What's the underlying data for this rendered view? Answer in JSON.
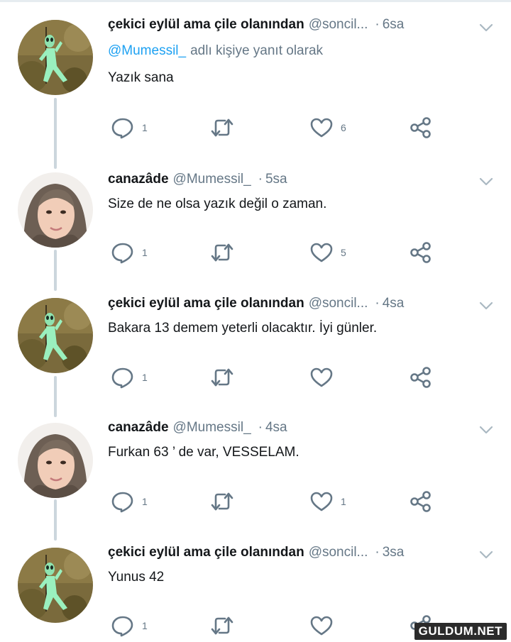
{
  "tweets": [
    {
      "author": "çekici eylül ama çile olanından",
      "handle": "@soncil...",
      "time": "6sa",
      "reply_to_handle": "@Mumessil_",
      "reply_to_suffix": "adlı kişiye yanıt olarak",
      "text": "Yazık sana",
      "replies": "1",
      "likes": "6",
      "avatar": "alien"
    },
    {
      "author": "canazâde",
      "handle": "@Mumessil_",
      "time": "5sa",
      "text": "Size de ne olsa yazık değil o zaman.",
      "replies": "1",
      "likes": "5",
      "avatar": "woman"
    },
    {
      "author": "çekici eylül ama çile olanından",
      "handle": "@soncil...",
      "time": "4sa",
      "text": "Bakara 13 demem yeterli olacaktır. İyi günler.",
      "replies": "1",
      "likes": "",
      "avatar": "alien"
    },
    {
      "author": "canazâde",
      "handle": "@Mumessil_",
      "time": "4sa",
      "text": "Furkan 63 ’ de var, VESSELAM.",
      "replies": "1",
      "likes": "1",
      "avatar": "woman"
    },
    {
      "author": "çekici eylül ama çile olanından",
      "handle": "@soncil...",
      "time": "3sa",
      "text": "Yunus 42",
      "replies": "1",
      "likes": "",
      "avatar": "alien"
    }
  ],
  "separator": "·",
  "icons": {
    "reply": "reply-icon",
    "retweet": "retweet-icon",
    "like": "heart-icon",
    "share": "share-icon",
    "menu": "chevron-down-icon"
  },
  "colors": {
    "text": "#14171a",
    "muted": "#657786",
    "link": "#1da1f2",
    "thread_line": "#ccd6dd"
  },
  "watermark": "GULDUM.NET"
}
